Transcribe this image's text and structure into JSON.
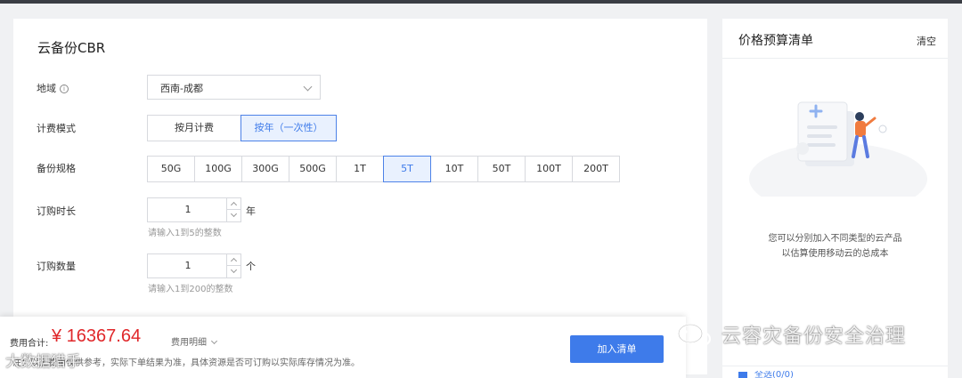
{
  "form": {
    "title": "云备份CBR",
    "region": {
      "label": "地域",
      "info_icon": "info-icon",
      "value": "西南-成都"
    },
    "billing": {
      "label": "计费模式",
      "options": [
        "按月计费",
        "按年（一次性）"
      ],
      "selected": "按年（一次性）"
    },
    "spec": {
      "label": "备份规格",
      "options": [
        "50G",
        "100G",
        "300G",
        "500G",
        "1T",
        "5T",
        "10T",
        "50T",
        "100T",
        "200T"
      ],
      "selected": "5T"
    },
    "duration": {
      "label": "订购时长",
      "value": "1",
      "unit": "年",
      "hint": "请输入1到5的整数"
    },
    "quantity": {
      "label": "订购数量",
      "value": "1",
      "unit": "个",
      "hint": "请输入1到200的整数"
    }
  },
  "footer": {
    "total_label": "费用合计:",
    "price": "¥ 16367.64",
    "detail_label": "费用明细",
    "note": "注：以上费用仅供参考，实际下单结果为准，具体资源是否可订购以实际库存情况为准。",
    "add_button": "加入清单"
  },
  "budget": {
    "title": "价格预算清单",
    "clear": "清空",
    "empty_line1": "您可以分别加入不同类型的云产品",
    "empty_line2": "以估算使用移动云的总成本",
    "bottom_item": "全选(0/0)"
  },
  "watermarks": {
    "right": "云容灾备份安全治理",
    "left": "大数据猎手"
  },
  "colors": {
    "accent": "#3e7bea",
    "price": "#e0272a",
    "selected_bg": "#e9f1fe"
  }
}
